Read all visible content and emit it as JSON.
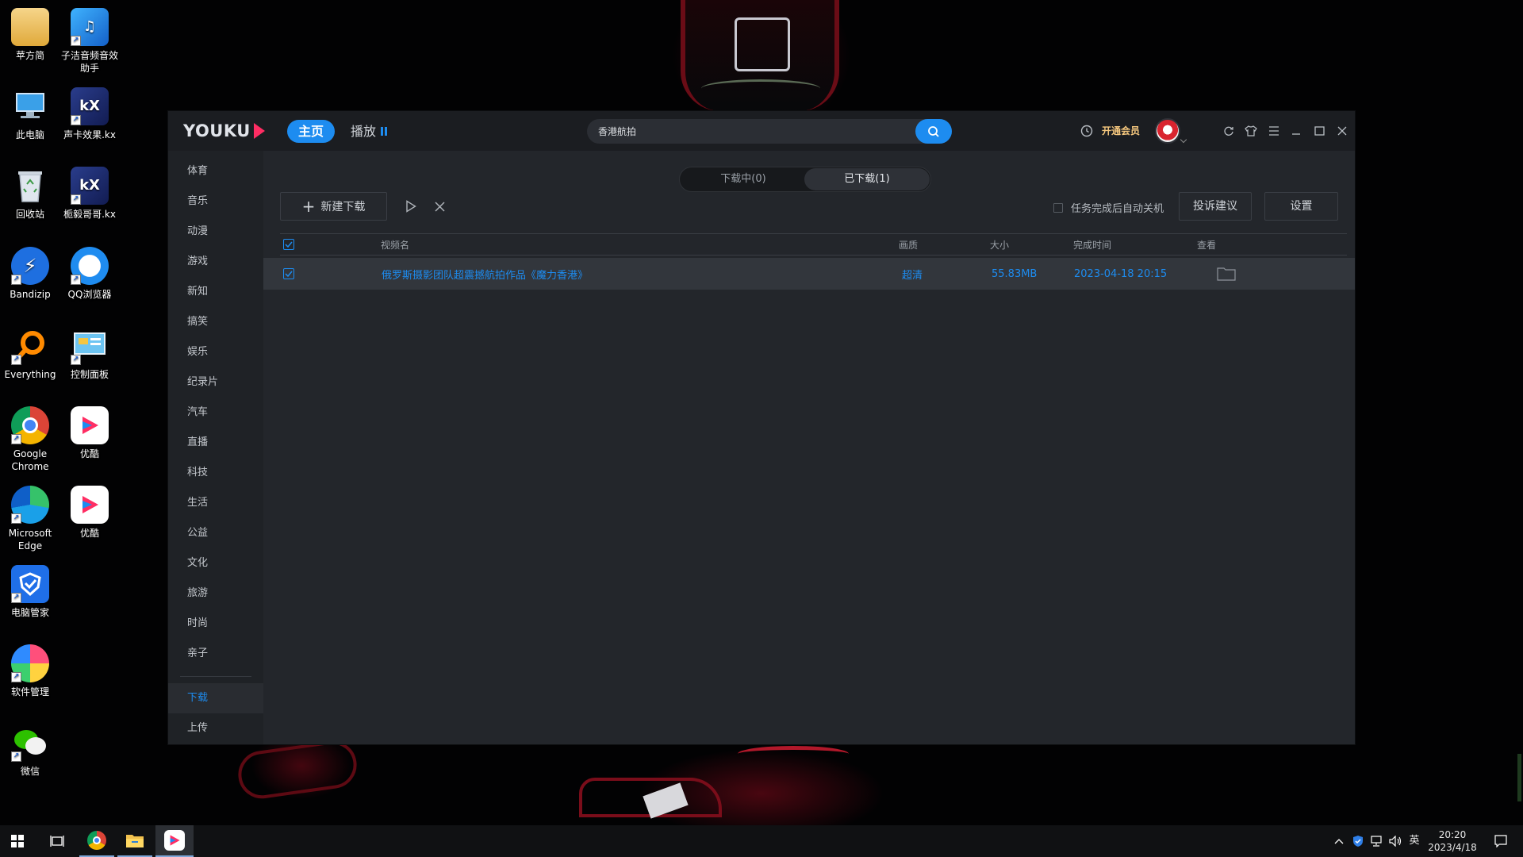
{
  "desktop": {
    "icons": [
      {
        "label": "苹方简",
        "icon": "folder-icon"
      },
      {
        "label": "子洁音频音效助手",
        "icon": "audio-app-icon"
      },
      {
        "label": "此电脑",
        "icon": "computer-icon"
      },
      {
        "label": "声卡效果.kx",
        "icon": "kx-file-icon"
      },
      {
        "label": "回收站",
        "icon": "recycle-bin-icon"
      },
      {
        "label": "栀毅哥哥.kx",
        "icon": "kx-file-icon"
      },
      {
        "label": "Bandizip",
        "icon": "bandizip-icon"
      },
      {
        "label": "QQ浏览器",
        "icon": "qq-browser-icon"
      },
      {
        "label": "Everything",
        "icon": "everything-search-icon"
      },
      {
        "label": "控制面板",
        "icon": "control-panel-icon"
      },
      {
        "label": "Google Chrome",
        "icon": "chrome-icon"
      },
      {
        "label": "优酷",
        "icon": "youku-icon"
      },
      {
        "label": "Microsoft Edge",
        "icon": "edge-icon"
      },
      {
        "label": "优酷",
        "icon": "youku-icon"
      },
      {
        "label": "电脑管家",
        "icon": "pc-manager-icon"
      },
      {
        "label": "软件管理",
        "icon": "software-manager-icon"
      },
      {
        "label": "微信",
        "icon": "wechat-icon"
      }
    ]
  },
  "app": {
    "logo": "YOUKU",
    "nav": {
      "home": "主页",
      "play": "播放"
    },
    "search": {
      "value": "香港航拍"
    },
    "vip_label": "开通会员",
    "sidebar": {
      "categories": [
        "体育",
        "音乐",
        "动漫",
        "游戏",
        "新知",
        "搞笑",
        "娱乐",
        "纪录片",
        "汽车",
        "直播",
        "科技",
        "生活",
        "公益",
        "文化",
        "旅游",
        "时尚",
        "亲子"
      ],
      "download": "下载",
      "upload": "上传"
    },
    "tabs": {
      "downloading": "下载中(0)",
      "downloaded": "已下载(1)"
    },
    "toolbar": {
      "new_download": "新建下载",
      "auto_shutdown": "任务完成后自动关机",
      "feedback": "投诉建议",
      "settings": "设置"
    },
    "table": {
      "headers": {
        "name": "视频名",
        "quality": "画质",
        "size": "大小",
        "finished": "完成时间",
        "view": "查看"
      },
      "rows": [
        {
          "name": "俄罗斯摄影团队超震撼航拍作品《魔力香港》",
          "quality": "超清",
          "size": "55.83MB",
          "finished": "2023-04-18 20:15"
        }
      ]
    }
  },
  "taskbar": {
    "time": "20:20",
    "date": "2023/4/18",
    "ime": "英"
  },
  "colors": {
    "accent": "#1d8cf0",
    "vip": "#f5c77e",
    "logo_mark": "#ff2d63"
  }
}
